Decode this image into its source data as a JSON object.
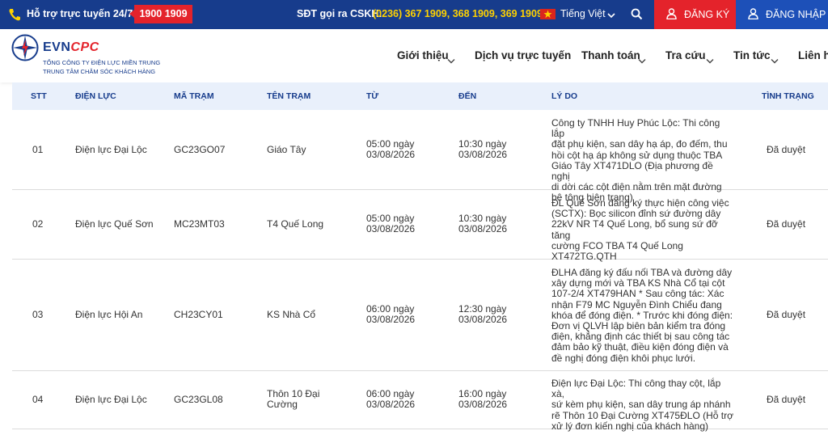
{
  "topbar": {
    "hotline_label": "Hỗ trợ trực tuyến 24/7:",
    "hotline_number": "1900 1909",
    "cskh_label": "SĐT gọi ra CSKH:",
    "cskh_numbers": "(0236) 367 1909, 368 1909, 369 1909",
    "language": "Tiếng Việt",
    "register_label": "ĐĂNG KÝ",
    "login_label": "ĐĂNG NHẬP",
    "colors": {
      "bar": "#173c8c",
      "accent_red": "#e4232b",
      "yellow": "#ffd200"
    }
  },
  "header": {
    "logo_evn": "EVN",
    "logo_cpc": "CPC",
    "logo_sub1": "TỔNG CÔNG TY ĐIỆN LỰC MIỀN TRUNG",
    "logo_sub2": "TRUNG TÂM CHĂM SÓC KHÁCH HÀNG",
    "nav": [
      "Giới thiệu",
      "Dịch vụ trực tuyến",
      "Thanh toán",
      "Tra cứu",
      "Tin tức",
      "Liên hệ"
    ]
  },
  "table": {
    "columns": [
      "STT",
      "ĐIỆN LỰC",
      "MÃ TRẠM",
      "TÊN TRẠM",
      "TỪ",
      "ĐẾN",
      "LÝ DO",
      "TÌNH TRẠNG"
    ],
    "rows": [
      {
        "stt": "01",
        "dien_luc": "Điện lực Đại Lộc",
        "ma_tram": "GC23GO07",
        "ten_tram": "Giáo Tây",
        "tu": [
          "05:00 ngày",
          "03/08/2026"
        ],
        "den": [
          "10:30 ngày",
          "03/08/2026"
        ],
        "ly_do": [
          "Công ty TNHH Huy Phúc Lộc: Thi công lắp",
          "đặt phụ kiện, san dây hạ áp, đo đếm, thu",
          "hồi cột hạ áp không sử dụng thuộc TBA",
          "Giáo Tây XT471DLO (Địa phương đề nghị",
          "di dời các cột điện nằm trên mặt đường",
          "bê tông hiện trạng)"
        ],
        "tinh_trang": "Đã duyệt"
      },
      {
        "stt": "02",
        "dien_luc": "Điện lực Quế Sơn",
        "ma_tram": "MC23MT03",
        "ten_tram": "T4 Quế Long",
        "tu": [
          "05:00 ngày",
          "03/08/2026"
        ],
        "den": [
          "10:30 ngày",
          "03/08/2026"
        ],
        "ly_do": [
          "ĐL Quế Sơn đăng ký thực hiện công việc",
          "(SCTX): Bọc silicon đỉnh sứ đường dây",
          "22kV NR T4 Quế Long, bổ sung sứ đỡ tăng",
          "cường FCO TBA T4 Quế Long",
          "XT472TG.QTH"
        ],
        "tinh_trang": "Đã duyệt"
      },
      {
        "stt": "03",
        "dien_luc": "Điện lực Hội An",
        "ma_tram": "CH23CY01",
        "ten_tram": "KS Nhà Cổ",
        "tu": [
          "06:00 ngày",
          "03/08/2026"
        ],
        "den": [
          "12:30 ngày",
          "03/08/2026"
        ],
        "ly_do": [
          "ĐLHA đăng ký đấu nối TBA và đường dây",
          "xây dựng mới và TBA KS Nhà Cổ tại cột",
          "107-2/4 XT479HAN * Sau công tác: Xác",
          "nhận F79 MC Nguyễn Đình Chiểu đang",
          "khóa để đóng điện. * Trước khi đóng điện:",
          "Đơn vị QLVH lập biên bản kiểm tra đóng",
          "điện, khẳng định các thiết bị sau công tác",
          "đảm bảo kỹ thuật, điều kiện đóng điện và",
          "đề nghị đóng điện khôi phục lưới."
        ],
        "tinh_trang": "Đã duyệt"
      },
      {
        "stt": "04",
        "dien_luc": "Điện lực Đại Lộc",
        "ma_tram": "GC23GL08",
        "ten_tram": [
          "Thôn 10 Đại",
          "Cường"
        ],
        "tu": [
          "06:00 ngày",
          "03/08/2026"
        ],
        "den": [
          "16:00 ngày",
          "03/08/2026"
        ],
        "ly_do": [
          "Điện lực Đại Lộc: Thi công thay cột, lắp xà,",
          "sứ kèm phụ kiện, san dây trung áp nhánh",
          "rẽ Thôn 10 Đại Cường XT475ĐLO (Hỗ trợ",
          "xử lý đơn kiến nghị của khách hàng)"
        ],
        "tinh_trang": "Đã duyệt"
      }
    ]
  }
}
